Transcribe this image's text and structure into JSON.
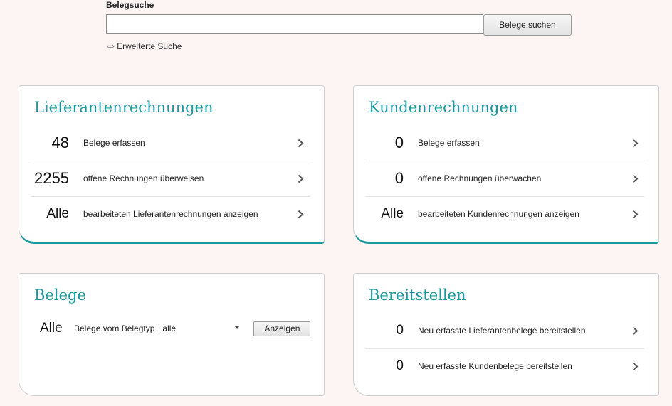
{
  "search": {
    "label": "Belegsuche",
    "value": "",
    "placeholder": "",
    "button_label": "Belege suchen",
    "advanced_label": "Erweiterte Suche"
  },
  "supplier_invoices": {
    "title": "Lieferantenrechnungen",
    "rows": [
      {
        "count": "48",
        "label": "Belege erfassen"
      },
      {
        "count": "2255",
        "label": "offene Rechnungen überweisen"
      },
      {
        "count": "Alle",
        "label": "bearbeiteten Lieferantenrechnungen anzeigen"
      }
    ]
  },
  "customer_invoices": {
    "title": "Kundenrechnungen",
    "rows": [
      {
        "count": "0",
        "label": "Belege erfassen"
      },
      {
        "count": "0",
        "label": "offene Rechnungen überwachen"
      },
      {
        "count": "Alle",
        "label": "bearbeiteten Kundenrechnungen anzeigen"
      }
    ]
  },
  "documents": {
    "title": "Belege",
    "count": "Alle",
    "label": "Belege vom Belegtyp",
    "type_selected": "alle",
    "button_label": "Anzeigen"
  },
  "provide": {
    "title": "Bereitstellen",
    "rows": [
      {
        "count": "0",
        "label": "Neu erfasste Lieferantenbelege bereitstellen"
      },
      {
        "count": "0",
        "label": "Neu erfasste Kundenbelege bereitstellen"
      }
    ]
  },
  "colors": {
    "accent": "#1a9a9c",
    "background": "#fdf4f4"
  }
}
